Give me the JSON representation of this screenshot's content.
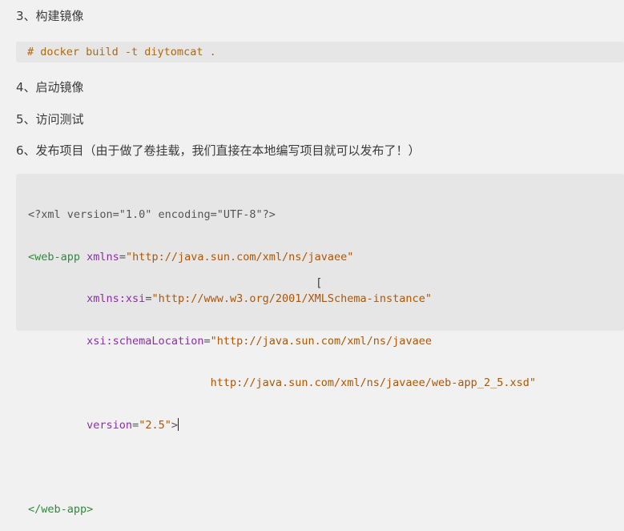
{
  "steps": {
    "build": "3、构建镜像",
    "start": "4、启动镜像",
    "test": "5、访问测试",
    "publish": "6、发布项目（由于做了卷挂载，我们直接在本地编写项目就可以发布了！）"
  },
  "command": "# docker build -t diytomcat .",
  "xml": {
    "declaration": "<?xml version=\"1.0\" encoding=\"UTF-8\"?>",
    "open_tag": "<web-app",
    "xmlns_attr": "xmlns",
    "xmlns_val": "\"http://java.sun.com/xml/ns/javaee\"",
    "xsi_attr": "xmlns:xsi",
    "xsi_val": "\"http://www.w3.org/2001/XMLSchema-instance\"",
    "schema_attr": "xsi:schemaLocation",
    "schema_val_1": "\"http://java.sun.com/xml/ns/javaee",
    "schema_val_2": "http://java.sun.com/xml/ns/javaee/web-app_2_5.xsd\"",
    "version_attr": "version",
    "version_val": "\"2.5\"",
    "close_bracket": ">",
    "close_tag": "</web-app>"
  },
  "colors": {
    "tag": "#2f8a3a",
    "attribute": "#8a2fa8",
    "string": "#b25500",
    "command": "#b0690b",
    "code_background": "#e6e6e6"
  }
}
